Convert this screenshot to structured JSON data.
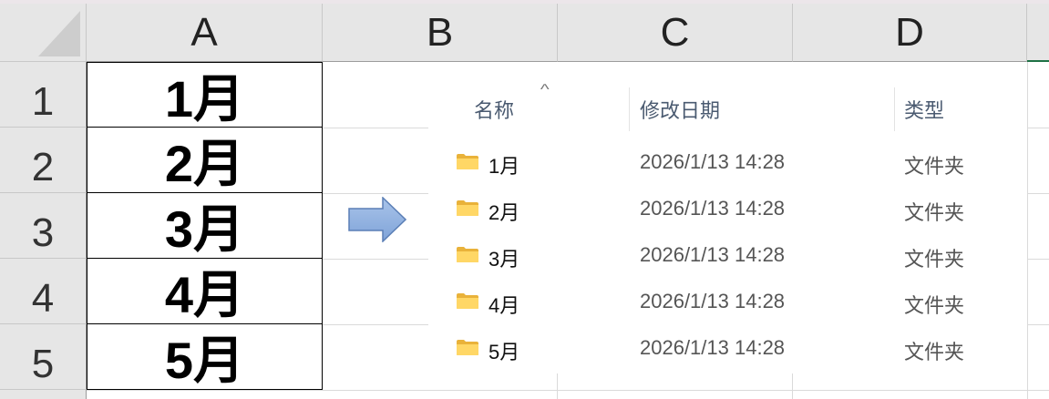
{
  "columns": [
    "A",
    "B",
    "C",
    "D"
  ],
  "rows": [
    "1",
    "2",
    "3",
    "4",
    "5"
  ],
  "column_a_values": [
    "1月",
    "2月",
    "3月",
    "4月",
    "5月"
  ],
  "arrow_icon": "right-arrow-icon",
  "explorer": {
    "headers": {
      "name": "名称",
      "modified": "修改日期",
      "type": "类型"
    },
    "sort_indicator": "^",
    "folder_icon": "folder-icon",
    "items": [
      {
        "name": "1月",
        "modified": "2026/1/13 14:28",
        "type": "文件夹"
      },
      {
        "name": "2月",
        "modified": "2026/1/13 14:28",
        "type": "文件夹"
      },
      {
        "name": "3月",
        "modified": "2026/1/13 14:28",
        "type": "文件夹"
      },
      {
        "name": "4月",
        "modified": "2026/1/13 14:28",
        "type": "文件夹"
      },
      {
        "name": "5月",
        "modified": "2026/1/13 14:28",
        "type": "文件夹"
      }
    ]
  }
}
